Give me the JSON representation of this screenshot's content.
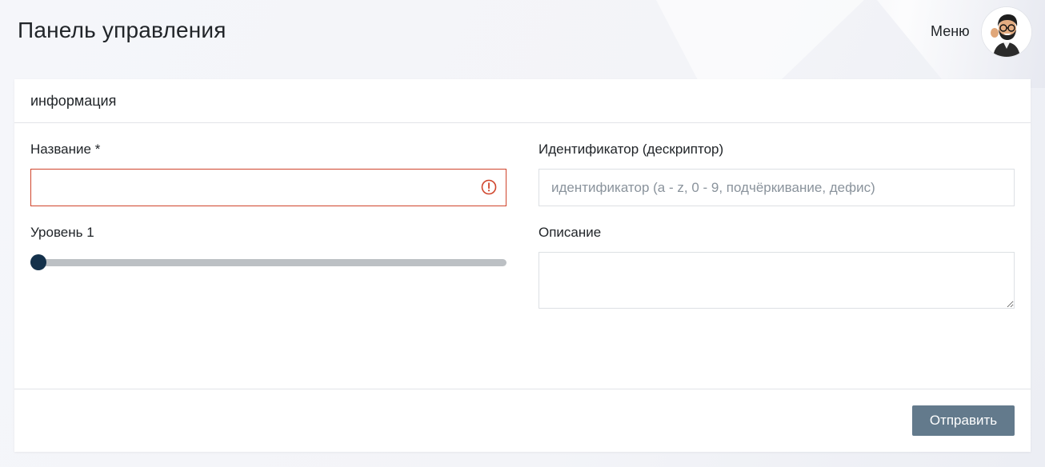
{
  "header": {
    "title": "Панель управления",
    "menu_label": "Меню",
    "avatar_icon": "avatar-cartoon-man"
  },
  "card": {
    "title": "информация",
    "fields": {
      "name": {
        "label": "Название *",
        "value": "",
        "state": "invalid",
        "error_icon": "exclamation-circle-icon",
        "error_color": "#d0452c"
      },
      "identifier": {
        "label": "Идентификатор (дескриптор)",
        "value": "",
        "placeholder": "идентификатор (a - z, 0 - 9, подчёркивание, дефис)"
      },
      "level": {
        "label": "Уровень 1",
        "value_fraction": 0.0
      },
      "description": {
        "label": "Описание",
        "value": ""
      }
    },
    "submit_label": "Отправить"
  },
  "colors": {
    "accent": "#637a8c",
    "slider_thumb": "#14314b",
    "slider_track": "#bcc0c4",
    "error": "#d0452c"
  }
}
